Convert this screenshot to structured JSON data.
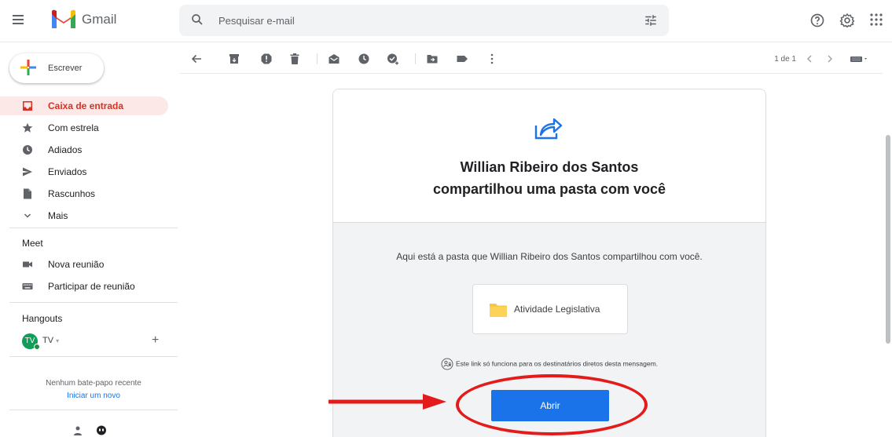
{
  "app": {
    "name": "Gmail"
  },
  "search": {
    "placeholder": "Pesquisar e-mail"
  },
  "compose": {
    "label": "Escrever"
  },
  "sidebar": {
    "items": [
      {
        "label": "Caixa de entrada",
        "icon": "inbox-icon",
        "active": true
      },
      {
        "label": "Com estrela",
        "icon": "star-icon"
      },
      {
        "label": "Adiados",
        "icon": "clock-icon"
      },
      {
        "label": "Enviados",
        "icon": "send-icon"
      },
      {
        "label": "Rascunhos",
        "icon": "draft-icon"
      },
      {
        "label": "Mais",
        "icon": "chevron-down-icon"
      }
    ],
    "meet": {
      "title": "Meet",
      "items": [
        {
          "label": "Nova reunião",
          "icon": "video-icon"
        },
        {
          "label": "Participar de reunião",
          "icon": "keyboard-icon"
        }
      ]
    },
    "hangouts": {
      "title": "Hangouts",
      "user": {
        "initials": "TV",
        "name": "TV"
      },
      "no_chat": "Nenhum bate-papo recente",
      "new_chat": "Iniciar um novo"
    }
  },
  "toolbar": {
    "pager": "1 de 1"
  },
  "email": {
    "title_line1": "Willian Ribeiro dos Santos",
    "title_line2": "compartilhou uma pasta com você",
    "description": "Aqui está a pasta que Willian Ribeiro dos Santos compartilhou com você.",
    "folder_name": "Atividade Legislativa",
    "link_note": "Este link só funciona para os destinatários diretos desta mensagem.",
    "open_button": "Abrir"
  },
  "colors": {
    "accent": "#1a73e8",
    "active_nav_bg": "#fce8e6",
    "active_nav_text": "#d93025",
    "annotation_red": "#e31b1b",
    "folder_yellow": "#f8c83c"
  }
}
